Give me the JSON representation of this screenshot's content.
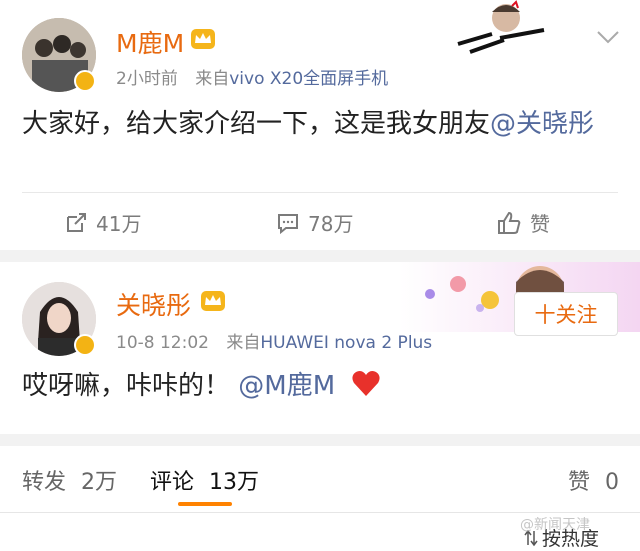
{
  "post1": {
    "username": "M鹿M",
    "time": "2小时前",
    "source_prefix": "来自",
    "source": "vivo X20全面屏手机",
    "text": "大家好，给大家介绍一下，这是我女朋友",
    "mention": "@关晓彤",
    "reposts": "41万",
    "comments": "78万",
    "likes": "赞"
  },
  "post2": {
    "username": "关晓彤",
    "time": "10-8 12:02",
    "source_prefix": "来自",
    "source": "HUAWEI nova 2 Plus",
    "text": "哎呀嘛，咔咔的！",
    "mention": "@M鹿M",
    "follow_label": "十关注"
  },
  "tabs": {
    "repost_label": "转发",
    "repost_count": "2万",
    "comment_label": "评论",
    "comment_count": "13万",
    "like_label": "赞",
    "like_count": "0"
  },
  "footer": {
    "sort_label": "按热度",
    "watermark": "@新闻天津"
  },
  "colors": {
    "username": "#e86a10",
    "link": "#546a9d",
    "heart": "#e8312b",
    "tab_underline": "#ff8200"
  }
}
